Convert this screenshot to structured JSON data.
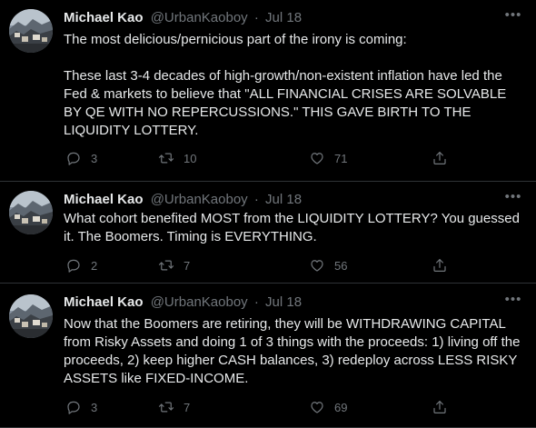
{
  "colors": {
    "background": "#000000",
    "text_primary": "#e7e9ea",
    "text_secondary": "#71767b",
    "divider": "#2f3336"
  },
  "tweets": [
    {
      "author_name": "Michael Kao",
      "handle": "@UrbanKaoboy",
      "separator": "·",
      "date": "Jul 18",
      "text": "The most delicious/pernicious part of the irony is coming:\n\nThese last 3-4 decades of high-growth/non-existent inflation have led the Fed & markets to believe that \"ALL FINANCIAL CRISES ARE SOLVABLE BY QE WITH NO REPERCUSSIONS.\" THIS GAVE BIRTH TO THE LIQUIDITY LOTTERY.",
      "replies": "3",
      "retweets": "10",
      "likes": "71",
      "icons": [
        "reply-icon",
        "retweet-icon",
        "like-icon",
        "share-icon",
        "more-icon"
      ]
    },
    {
      "author_name": "Michael Kao",
      "handle": "@UrbanKaoboy",
      "separator": "·",
      "date": "Jul 18",
      "text": "What cohort benefited MOST from the LIQUIDITY LOTTERY? You guessed it. The Boomers. Timing is EVERYTHING.",
      "replies": "2",
      "retweets": "7",
      "likes": "56",
      "icons": [
        "reply-icon",
        "retweet-icon",
        "like-icon",
        "share-icon",
        "more-icon"
      ]
    },
    {
      "author_name": "Michael Kao",
      "handle": "@UrbanKaoboy",
      "separator": "·",
      "date": "Jul 18",
      "text": "Now that the Boomers are retiring, they will be WITHDRAWING CAPITAL from Risky Assets and doing 1 of 3 things with the proceeds: 1) living off the proceeds, 2) keep higher CASH balances, 3) redeploy across LESS RISKY ASSETS like FIXED-INCOME.",
      "replies": "3",
      "retweets": "7",
      "likes": "69",
      "icons": [
        "reply-icon",
        "retweet-icon",
        "like-icon",
        "share-icon",
        "more-icon"
      ]
    }
  ]
}
